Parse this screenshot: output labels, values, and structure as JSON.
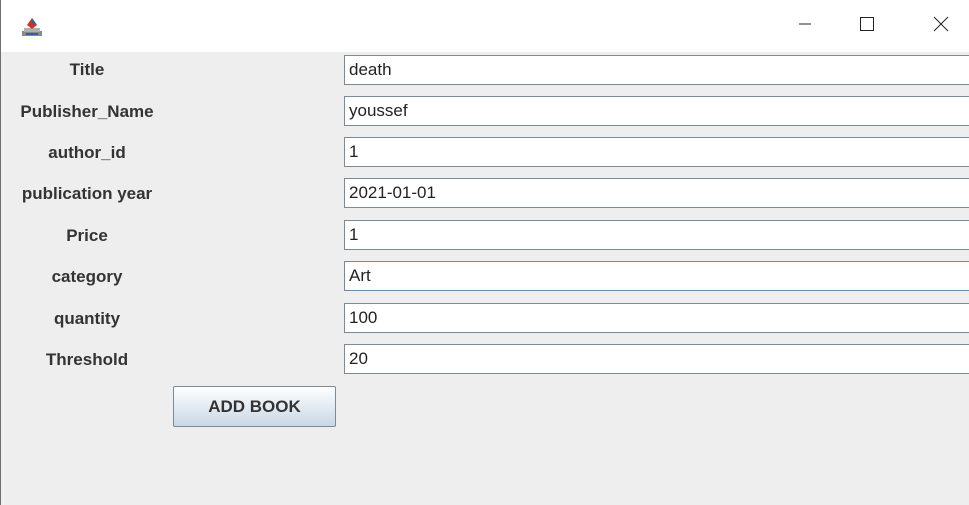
{
  "window": {
    "icons": {
      "app": "java-cup-icon",
      "minimize": "minimize-icon",
      "maximize": "maximize-icon",
      "close": "close-icon"
    }
  },
  "form": {
    "fields": [
      {
        "label": "Title",
        "value": "death"
      },
      {
        "label": "Publisher_Name",
        "value": "youssef"
      },
      {
        "label": "author_id",
        "value": "1"
      },
      {
        "label": "publication year",
        "value": "2021-01-01"
      },
      {
        "label": "Price",
        "value": "1"
      },
      {
        "label": "category",
        "value": "Art"
      },
      {
        "label": "quantity",
        "value": "100"
      },
      {
        "label": "Threshold",
        "value": "20"
      }
    ],
    "submit_label": "ADD BOOK"
  }
}
